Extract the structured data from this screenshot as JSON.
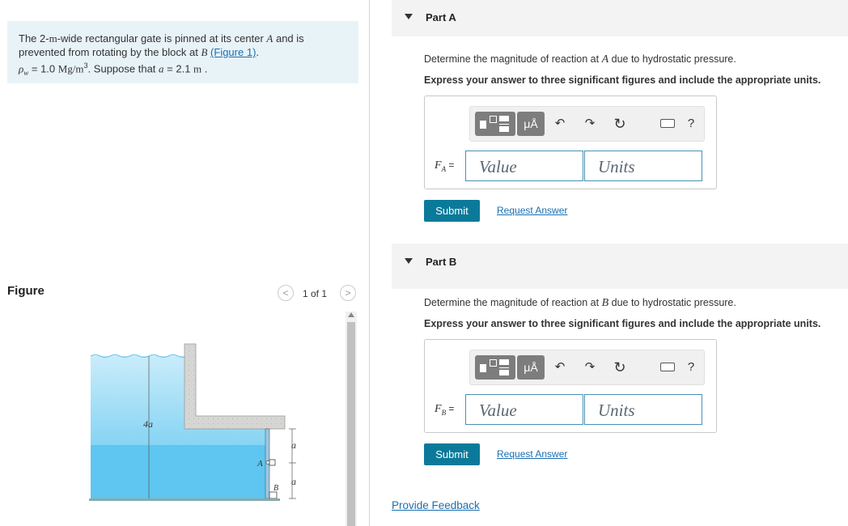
{
  "problem": {
    "line1_pre": "The 2-",
    "unit_m": "m",
    "line1_post": "-wide rectangular gate is pinned at its center ",
    "pin_point": "A",
    "line1_end": " and is",
    "line2_pre": "prevented from rotating by the block at ",
    "block_point": "B",
    "figure_link": "(Figure 1)",
    "line2_end": ".",
    "rho_symbol": "ρ",
    "rho_sub": "w",
    "rho_value": " = 1.0 ",
    "rho_units": "Mg/m",
    "rho_exp": "3",
    "line3_post": ". Suppose that ",
    "a_symbol": "a",
    "a_value": " = 2.1 ",
    "a_unit": "m",
    "line3_end": " ."
  },
  "figure": {
    "title": "Figure",
    "pager": "1 of 1",
    "prev": "<",
    "next": ">",
    "label_4a": "4a",
    "label_a_top": "a",
    "label_a_bottom": "a",
    "label_A": "A",
    "label_B": "B",
    "colors": {
      "water_top": "#c9ecfa",
      "water_bottom": "#5ec6f0",
      "concrete": "#d6d6d4",
      "gate": "#9cc8de"
    }
  },
  "parts": [
    {
      "title": "Part A",
      "question_pre": "Determine the magnitude of reaction at ",
      "question_point": "A",
      "question_post": " due to hydrostatic pressure.",
      "instruction": "Express your answer to three significant figures and include the appropriate units.",
      "var": "F",
      "var_sub": "A",
      "eq": " =",
      "value_placeholder": "Value",
      "units_placeholder": "Units",
      "submit": "Submit",
      "request_answer": "Request Answer"
    },
    {
      "title": "Part B",
      "question_pre": "Determine the magnitude of reaction at ",
      "question_point": "B",
      "question_post": " due to hydrostatic pressure.",
      "instruction": "Express your answer to three significant figures and include the appropriate units.",
      "var": "F",
      "var_sub": "B",
      "eq": " =",
      "value_placeholder": "Value",
      "units_placeholder": "Units",
      "submit": "Submit",
      "request_answer": "Request Answer"
    }
  ],
  "toolbar": {
    "units_button": "μÅ",
    "undo_icon": "↶",
    "redo_icon": "↷",
    "reset_icon": "↻",
    "help_icon": "?"
  },
  "feedback": "Provide Feedback"
}
